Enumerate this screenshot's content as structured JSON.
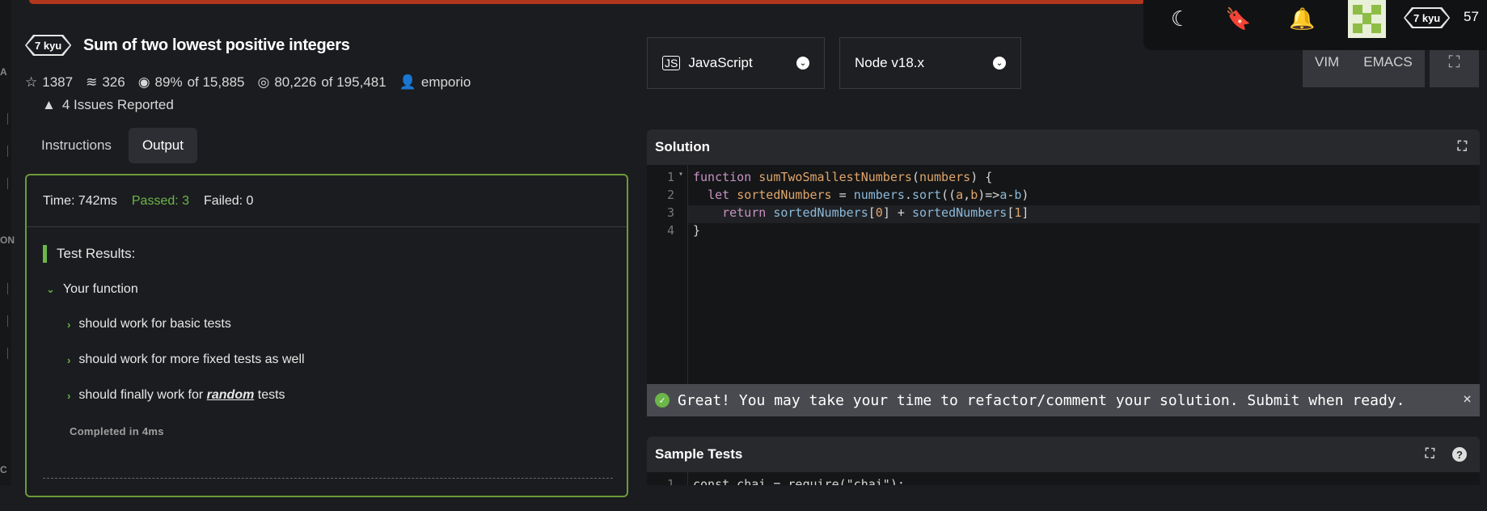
{
  "kata": {
    "rank": "7 kyu",
    "title": "Sum of two lowest positive integers",
    "stars": "1387",
    "collections": "326",
    "satisfaction_pct": "89%",
    "satisfaction_of": "of 15,885",
    "completed": "80,226",
    "completed_of": "of 195,481",
    "author": "emporio",
    "issues": "4 Issues Reported"
  },
  "tabs": [
    "Instructions",
    "Output"
  ],
  "output": {
    "time": "Time: 742ms",
    "passed": "Passed: 3",
    "failed": "Failed: 0",
    "results_title": "Test Results:",
    "group": "Your function",
    "tests": [
      {
        "pre": "should work for basic tests",
        "em": "",
        "post": ""
      },
      {
        "pre": "should work for more fixed tests as well",
        "em": "",
        "post": ""
      },
      {
        "pre": "should finally work for ",
        "em": "random",
        "post": " tests"
      }
    ],
    "completed": "Completed in 4ms"
  },
  "language": {
    "label": "JavaScript",
    "icon": "js-icon"
  },
  "runtime": {
    "label": "Node v18.x"
  },
  "modes": [
    "VIM",
    "EMACS"
  ],
  "user": {
    "rank": "7 kyu",
    "honor": "57"
  },
  "solution": {
    "title": "Solution",
    "line_numbers": [
      "1",
      "2",
      "3",
      "4"
    ],
    "banner": "Great! You may take your time to refactor/comment your solution. Submit when ready."
  },
  "sample_tests": {
    "title": "Sample Tests",
    "line_numbers": [
      "1"
    ],
    "first_line": "const chai = require(\"chai\");"
  },
  "colors": {
    "accent_green": "#6cb64a",
    "top_bar": "#b1361e",
    "panel_border": "#6c9a3a"
  }
}
